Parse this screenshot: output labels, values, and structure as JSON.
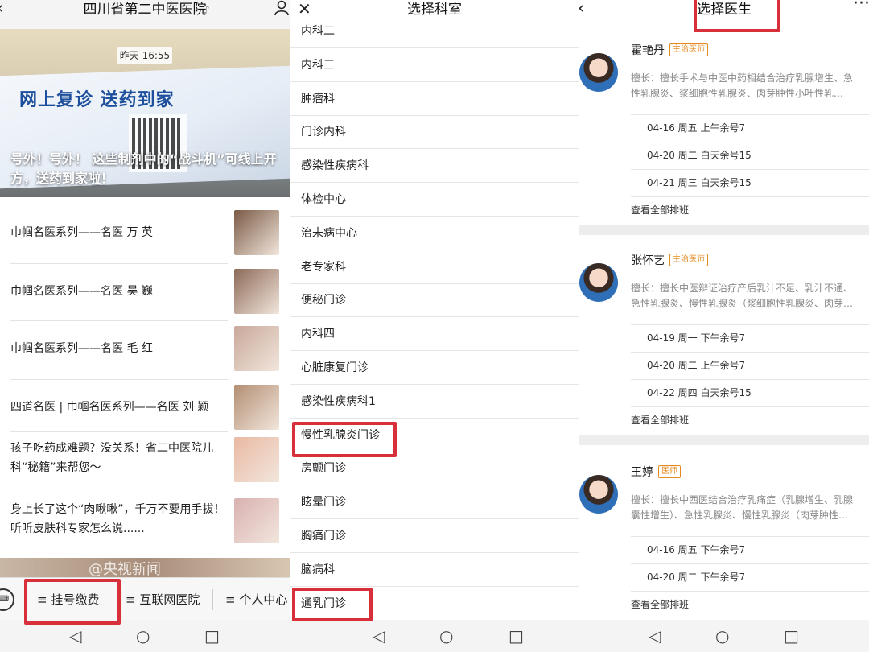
{
  "panel1": {
    "header": {
      "back_icon": "chevron-left-icon",
      "title": "四川省第二中医医院",
      "verified_icon": "ear-icon",
      "profile_icon": "person-icon"
    },
    "banner": {
      "time": "昨天 16:55",
      "slogan": "网上复诊 送药到家",
      "caption": "号外！号外！ 这些制剂中的“战斗机”可线上开方，送药到家啦！"
    },
    "news": [
      {
        "title": "巾帼名医系列——名医 万 英",
        "thumb_color": "#7a5a45"
      },
      {
        "title": "巾帼名医系列——名医 吴 巍",
        "thumb_color": "#8c6a58"
      },
      {
        "title": "巾帼名医系列——名医 毛 红",
        "thumb_color": "#c9a89a"
      },
      {
        "title": "四道名医 | 巾帼名医系列——名医 刘 颖",
        "thumb_color": "#b38e72"
      },
      {
        "title": "孩子吃药成难题？没关系！省二中医院儿科“秘籍”来帮您～",
        "thumb_color": "#e9b9a3"
      },
      {
        "title": "身上长了这个“肉啾啾”，千万不要用手拔！听听皮肤科专家怎么说......",
        "thumb_color": "#d9b1b0"
      }
    ],
    "strip_text": "@央视新闻",
    "tabs": [
      {
        "label": "≡ 挂号缴费"
      },
      {
        "label": "≡ 互联网医院"
      },
      {
        "label": "≡ 个人中心"
      }
    ],
    "keyboard_icon": "keyboard-icon"
  },
  "panel2": {
    "header": {
      "close_icon": "close-icon",
      "title": "选择科室"
    },
    "departments": [
      "内科二",
      "内科三",
      "肿瘤科",
      "门诊内科",
      "感染性疾病科",
      "体检中心",
      "治未病中心",
      "老专家科",
      "便秘门诊",
      "内科四",
      "心脏康复门诊",
      "感染性疾病科1",
      "慢性乳腺炎门诊",
      "房颤门诊",
      "眩晕门诊",
      "胸痛门诊",
      "脑病科",
      "通乳门诊"
    ]
  },
  "panel3": {
    "header": {
      "back_icon": "chevron-left-icon",
      "title": "选择医生",
      "more_icon": "more-dots-icon"
    },
    "doctors": [
      {
        "name": "霍艳丹",
        "title": "主治医师",
        "spec1": "擅长：擅长手术与中医中药相结合治疗乳腺增生、急",
        "spec2": "性乳腺炎、浆细胞性乳腺炎、肉芽肿性小叶性乳…",
        "slots": [
          "04-16 周五  上午余号7",
          "04-20 周二  白天余号15",
          "04-21 周三  白天余号15"
        ],
        "view_all": "查看全部排班"
      },
      {
        "name": "张怀艺",
        "title": "主治医师",
        "spec1": "擅长：擅长中医辩证治疗产后乳汁不足、乳汁不通、",
        "spec2": "急性乳腺炎、慢性乳腺炎（浆细胞性乳腺炎、肉芽…",
        "slots": [
          "04-19 周一  下午余号7",
          "04-20 周二  上午余号7",
          "04-22 周四  白天余号15"
        ],
        "view_all": "查看全部排班"
      },
      {
        "name": "王婷",
        "title": "医师",
        "spec1": "擅长：擅长中西医结合治疗乳痛症（乳腺增生、乳腺",
        "spec2": "囊性增生）、急性乳腺炎、慢性乳腺炎（肉芽肿性…",
        "slots": [
          "04-16 周五  下午余号7",
          "04-20 周二  下午余号7"
        ],
        "view_all": "查看全部排班"
      }
    ]
  },
  "system_nav": {
    "back_icon": "triangle-back-icon",
    "home_icon": "circle-home-icon",
    "recents_icon": "square-recents-icon"
  },
  "colors": {
    "highlight": "#d8303a",
    "badge": "#e58a1f",
    "title_blue": "#1d4f9c"
  }
}
